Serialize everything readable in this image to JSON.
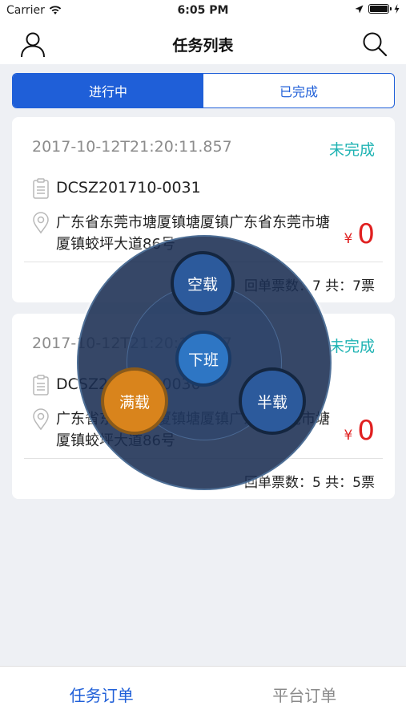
{
  "status_bar": {
    "carrier": "Carrier",
    "time": "6:05 PM"
  },
  "nav": {
    "title": "任务列表",
    "left_icon": "user-icon",
    "right_icon": "search-icon"
  },
  "segmented": {
    "tabs": [
      {
        "label": "进行中",
        "active": true
      },
      {
        "label": "已完成",
        "active": false
      }
    ]
  },
  "orders": [
    {
      "time": "2017-10-12T21:20:11.857",
      "status": "未完成",
      "id": "DCSZ201710-0031",
      "address": "广东省东莞市塘厦镇塘厦镇广东省东莞市塘厦镇蛟坪大道86号",
      "currency": "¥",
      "amount": "0",
      "footer": "回单票数：7 共：7票"
    },
    {
      "time": "2017-10-12T21:20:11.857",
      "status": "未完成",
      "id": "DCSZ201710-0030",
      "address": "广东省东莞市塘厦镇塘厦镇广东省东莞市塘厦镇蛟坪大道86号",
      "currency": "¥",
      "amount": "0",
      "footer": "回单票数：5 共：5票"
    }
  ],
  "radial_menu": {
    "items": [
      {
        "label": "空载"
      },
      {
        "label": "下班"
      },
      {
        "label": "半载"
      },
      {
        "label": "满载"
      }
    ]
  },
  "tab_bar": {
    "tabs": [
      {
        "label": "任务订单",
        "active": true
      },
      {
        "label": "平台订单",
        "active": false
      }
    ]
  },
  "colors": {
    "accent": "#1f5fd8",
    "status": "#1fb3b3",
    "price": "#e02020",
    "radial_bg": "#1a2e52",
    "highlight": "#d9841c"
  }
}
